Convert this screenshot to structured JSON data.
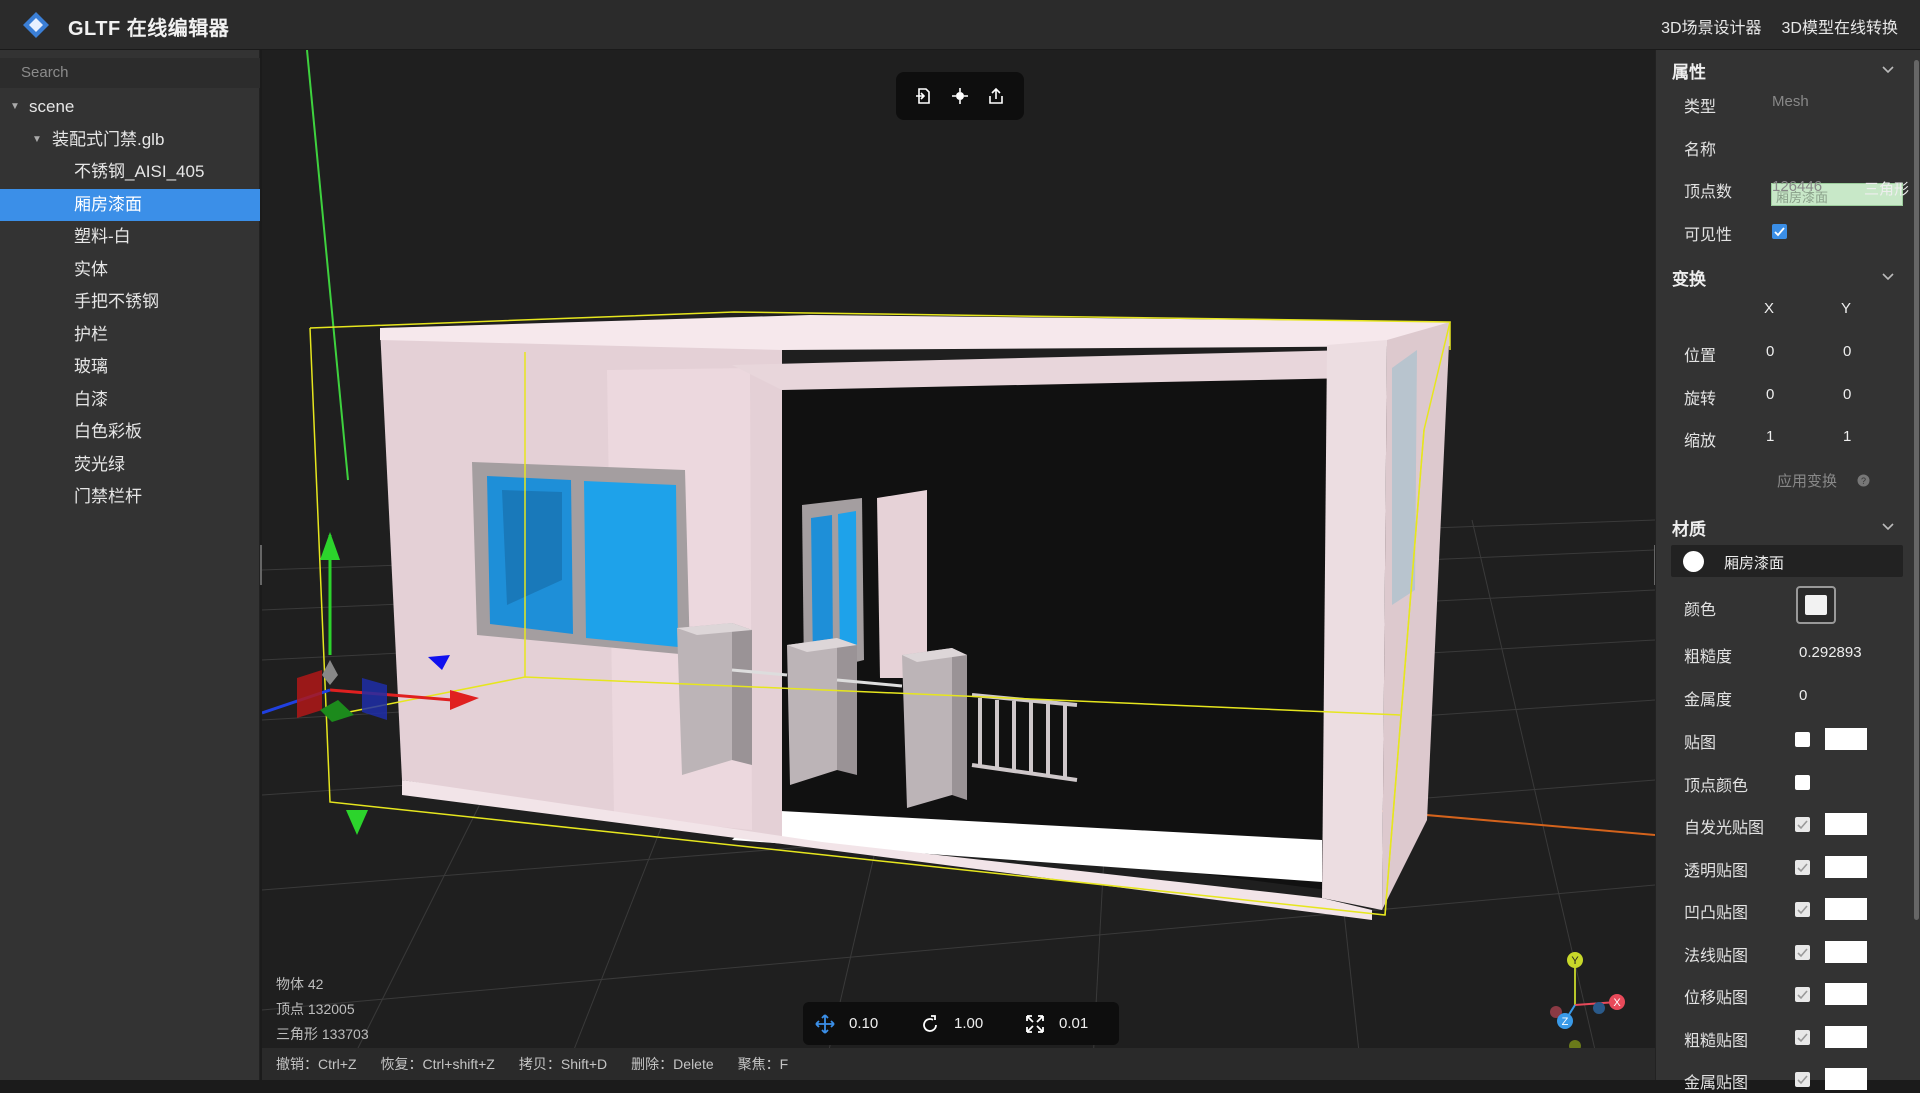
{
  "app": {
    "title": "GLTF 在线编辑器",
    "links": [
      "3D场景设计器",
      "3D模型在线转换"
    ],
    "colors": {
      "accent": "#3b8fe8",
      "panel": "#333333",
      "viewport": "#1f1f1f"
    }
  },
  "sidebar": {
    "search_placeholder": "Search",
    "tree": [
      {
        "label": "scene",
        "level": 0,
        "caret": true
      },
      {
        "label": "装配式门禁.glb",
        "level": 1,
        "caret": true
      },
      {
        "label": "不锈钢_AISI_405",
        "level": 2
      },
      {
        "label": "厢房漆面",
        "level": 2,
        "selected": true
      },
      {
        "label": "塑料-白",
        "level": 2
      },
      {
        "label": "实体",
        "level": 2
      },
      {
        "label": "手把不锈钢",
        "level": 2
      },
      {
        "label": "护栏",
        "level": 2
      },
      {
        "label": "玻璃",
        "level": 2
      },
      {
        "label": "白漆",
        "level": 2
      },
      {
        "label": "白色彩板",
        "level": 2
      },
      {
        "label": "荧光绿",
        "level": 2
      },
      {
        "label": "门禁栏杆",
        "level": 2
      }
    ]
  },
  "viewport": {
    "toolbar_icons": [
      "import-icon",
      "focus-icon",
      "export-icon"
    ],
    "stats": {
      "objects": "物体 42",
      "vertices": "顶点 132005",
      "triangles": "三角形 133703"
    },
    "snap": {
      "translate": "0.10",
      "rotate": "1.00",
      "scale": "0.01"
    },
    "shortcuts": [
      "撤销：Ctrl+Z",
      "恢复：Ctrl+shift+Z",
      "拷贝：Shift+D",
      "删除：Delete",
      "聚焦：F"
    ],
    "gizmo_axes": [
      "Y",
      "Z",
      "X"
    ]
  },
  "props": {
    "section_title": "属性",
    "type_label": "类型",
    "type_value": "Mesh",
    "name_label": "名称",
    "name_value": "厢房漆面",
    "vertex_label": "顶点数",
    "vertex_value": "126446",
    "tri_label_partial": "三角形",
    "visible_label": "可见性"
  },
  "transform": {
    "section_title": "变换",
    "col_x": "X",
    "col_y": "Y",
    "position_label": "位置",
    "position": [
      "0",
      "0"
    ],
    "rotation_label": "旋转",
    "rotation": [
      "0",
      "0"
    ],
    "scale_label": "缩放",
    "scale": [
      "1",
      "1"
    ],
    "apply_label": "应用变换"
  },
  "material": {
    "section_title": "材质",
    "name": "厢房漆面",
    "color_label": "颜色",
    "roughness_label": "粗糙度",
    "roughness_value": "0.292893",
    "metalness_label": "金属度",
    "metalness_value": "0",
    "maps": [
      {
        "label": "贴图",
        "checked": false,
        "tex": true
      },
      {
        "label": "顶点颜色",
        "checked": false,
        "tex": false
      },
      {
        "label": "自发光贴图",
        "checked": true,
        "tex": true
      },
      {
        "label": "透明贴图",
        "checked": true,
        "tex": true
      },
      {
        "label": "凹凸贴图",
        "checked": true,
        "tex": true
      },
      {
        "label": "法线贴图",
        "checked": true,
        "tex": true
      },
      {
        "label": "位移贴图",
        "checked": true,
        "tex": true
      },
      {
        "label": "粗糙贴图",
        "checked": true,
        "tex": true
      },
      {
        "label": "金属贴图",
        "checked": true,
        "tex": true
      }
    ]
  }
}
